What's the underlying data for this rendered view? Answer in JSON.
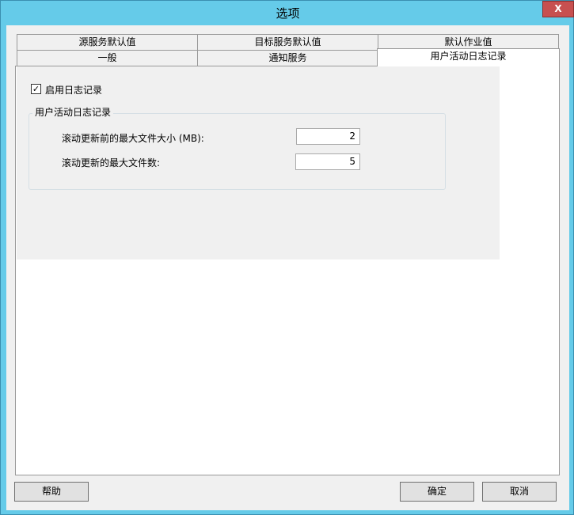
{
  "window": {
    "title": "选项",
    "close_label": "X"
  },
  "tabs_row1": [
    "源服务默认值",
    "目标服务默认值",
    "默认作业值"
  ],
  "tabs_row2": [
    "一般",
    "通知服务",
    "用户活动日志记录"
  ],
  "content": {
    "enable_logging_label": "启用日志记录",
    "enable_logging_checked": true,
    "check_mark": "✓",
    "group_title": "用户活动日志记录",
    "max_size_label": "滚动更新前的最大文件大小 (MB):",
    "max_size_value": "2",
    "max_files_label": "滚动更新的最大文件数:",
    "max_files_value": "5"
  },
  "buttons": {
    "help": "帮助",
    "ok": "确定",
    "cancel": "取消"
  }
}
